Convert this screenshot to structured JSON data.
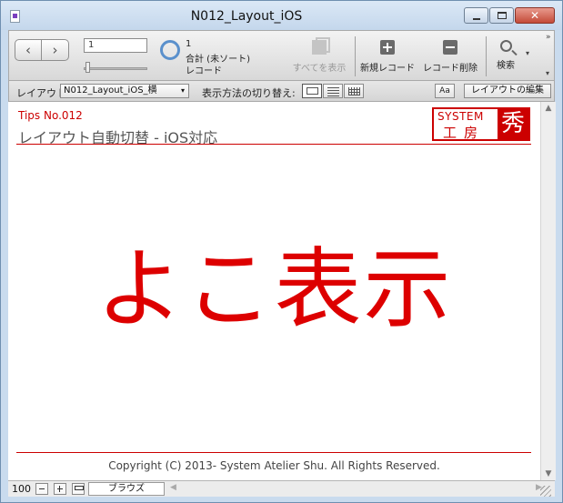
{
  "window": {
    "title": "N012_Layout_iOS",
    "close_glyph": "✕"
  },
  "toolbar": {
    "back_label": "‹",
    "forward_label": "›",
    "record_number": "1",
    "found_count": "1",
    "total_label": "合計 (未ソート)",
    "records_label": "レコード",
    "show_all_label": "すべてを表示",
    "new_record_label": "新規レコード",
    "delete_record_label": "レコード削除",
    "find_label": "検索"
  },
  "layoutbar": {
    "layout_label": "レイアウト:",
    "layout_value": "N012_Layout_iOS_横",
    "view_as_label": "表示方法の切り替え:",
    "aa_label": "Aa",
    "edit_layout_label": "レイアウトの編集"
  },
  "content": {
    "tips": "Tips No.012",
    "page_title": "レイアウト自動切替 - iOS対応",
    "logo_system": "SYSTEM",
    "logo_kobo": "工房",
    "logo_mark": "秀",
    "big_text": "よこ表示",
    "copyright": "Copyright (C) 2013- System Atelier Shu. All Rights Reserved."
  },
  "statusbar": {
    "zoom": "100",
    "mode": "ブラウズ"
  },
  "colors": {
    "accent_red": "#dd0000",
    "title_bar": "#c9dbee"
  },
  "icons": [
    "document-icon",
    "minimize-icon",
    "maximize-icon",
    "close-icon",
    "back-arrow-icon",
    "forward-arrow-icon",
    "pie-chart-icon",
    "show-all-icon",
    "plus-icon",
    "minus-icon",
    "search-icon"
  ]
}
